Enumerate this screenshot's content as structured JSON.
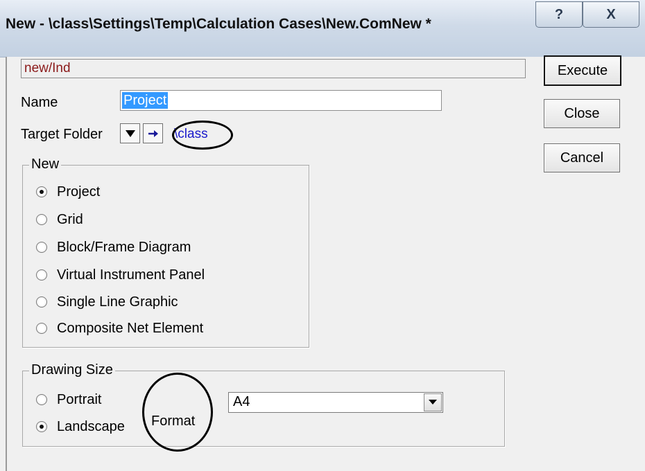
{
  "window": {
    "title": "New - \\class\\Settings\\Temp\\Calculation Cases\\New.ComNew *",
    "help_label": "?",
    "close_label": "X"
  },
  "path_field": {
    "value": "new/Ind"
  },
  "buttons": {
    "execute": "Execute",
    "close": "Close",
    "cancel": "Cancel"
  },
  "name": {
    "label": "Name",
    "value": "Project"
  },
  "target_folder": {
    "label": "Target Folder",
    "link": "\\class"
  },
  "new_group": {
    "title": "New",
    "options": [
      {
        "label": "Project",
        "checked": true
      },
      {
        "label": "Grid",
        "checked": false
      },
      {
        "label": "Block/Frame Diagram",
        "checked": false
      },
      {
        "label": "Virtual Instrument Panel",
        "checked": false
      },
      {
        "label": "Single Line Graphic",
        "checked": false
      },
      {
        "label": "Composite Net Element",
        "checked": false
      }
    ]
  },
  "drawing_size": {
    "title": "Drawing Size",
    "options": [
      {
        "label": "Portrait",
        "checked": false
      },
      {
        "label": "Landscape",
        "checked": true
      }
    ],
    "format_label": "Format",
    "format_value": "A4"
  },
  "icons": {
    "help": "help-icon",
    "close": "close-icon",
    "dropdown": "triangle-down-icon",
    "navigate": "arrow-right-icon"
  },
  "colors": {
    "selection": "#3399ff",
    "link": "#1a1acc",
    "path_text": "#8b1a1a"
  }
}
